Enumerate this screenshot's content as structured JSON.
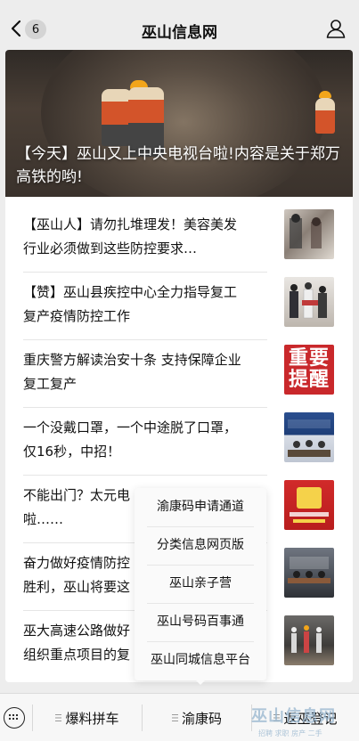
{
  "header": {
    "badge": "6",
    "title": "巫山信息网"
  },
  "hero": {
    "title": "【今天】巫山又上中央电视台啦!内容是关于郑万高铁的哟!"
  },
  "articles": [
    {
      "line1": "【巫山人】请勿扎堆理发！美容美发",
      "line2": "行业必须做到这些防控要求…",
      "thumb": "salon-photo"
    },
    {
      "line1": "【赞】巫山县疾控中心全力指导复工",
      "line2": "复产疫情防控工作",
      "thumb": "cdc-staff-photo"
    },
    {
      "line1": "重庆警方解读治安十条 支持保障企业",
      "line2": "复工复产",
      "thumb": "zhongyao-tixing-graphic",
      "thumb_text": "重要提醒"
    },
    {
      "line1": "一个没戴口罩，一个中途脱了口罩，",
      "line2": "仅16秒，中招！",
      "thumb": "press-conference-photo"
    },
    {
      "line1": "不能出门？太元电",
      "line2": "啦……",
      "thumb": "haier-promo-graphic"
    },
    {
      "line1": "奋力做好疫情防控",
      "line2": "胜利，巫山将要这",
      "thumb": "meeting-photo"
    },
    {
      "line1": "巫大高速公路做好",
      "line2": "组织重点项目的复",
      "thumb": "highway-worksite-photo"
    }
  ],
  "popup_menu": {
    "items": [
      "渝康码申请通道",
      "分类信息网页版",
      "巫山亲子营",
      "巫山号码百事通",
      "巫山同城信息平台"
    ]
  },
  "bottom_bar": {
    "menus": [
      "爆料拼车",
      "渝康码",
      "返巫登记"
    ]
  },
  "watermark": {
    "text": "巫山信息网",
    "sub": "招聘 求职 房产 二手"
  },
  "colors": {
    "accent_orange": "#f2a51a",
    "thumb_red": "#c9282b"
  }
}
